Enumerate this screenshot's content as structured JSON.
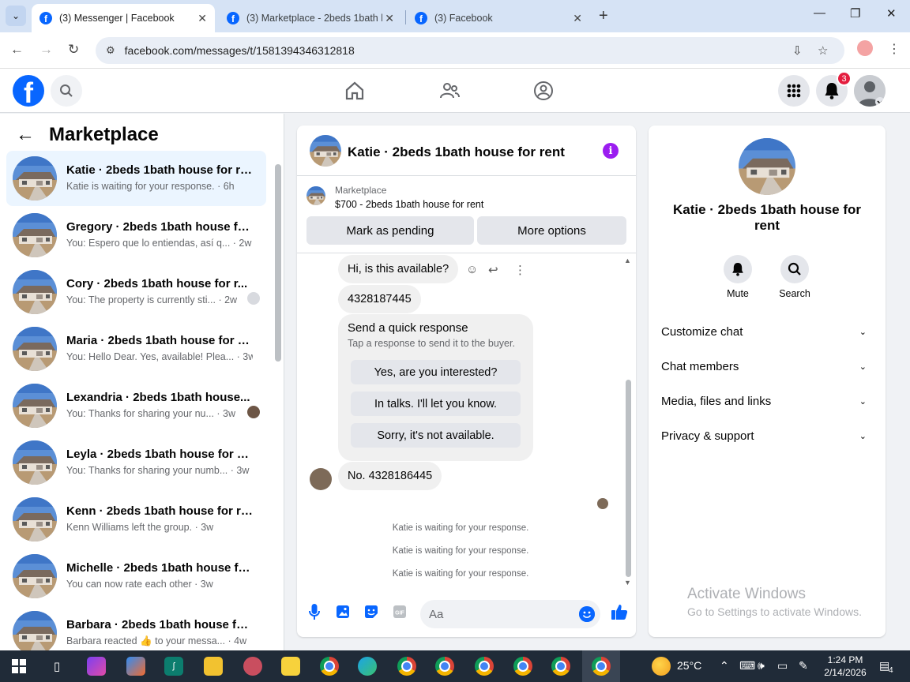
{
  "browser": {
    "tabs": [
      {
        "title": "(3) Messenger | Facebook",
        "active": true
      },
      {
        "title": "(3) Marketplace - 2beds 1bath h",
        "active": false
      },
      {
        "title": "(3) Facebook",
        "active": false
      }
    ],
    "url": "facebook.com/messages/t/1581394346312818"
  },
  "header": {
    "notification_count": "3"
  },
  "left": {
    "title": "Marketplace",
    "conversations": [
      {
        "name": "Katie · 2beds 1bath house for rent",
        "preview": "Katie is waiting for your response. · 6h",
        "selected": true
      },
      {
        "name": "Gregory · 2beds 1bath house for...",
        "preview": "You: Espero que lo entiendas, así q... · 2w"
      },
      {
        "name": "Cory · 2beds 1bath house for r...",
        "preview": "You: The property is currently sti... · 2w"
      },
      {
        "name": "Maria · 2beds 1bath house for re...",
        "preview": "You: Hello Dear. Yes, available! Plea... · 3w"
      },
      {
        "name": "Lexandria · 2beds 1bath house...",
        "preview": "You: Thanks for sharing your nu... · 3w"
      },
      {
        "name": "Leyla · 2beds 1bath house for rent",
        "preview": "You: Thanks for sharing your numb... · 3w"
      },
      {
        "name": "Kenn · 2beds 1bath house for rent",
        "preview": "Kenn Williams left the group. · 3w"
      },
      {
        "name": "Michelle · 2beds 1bath house for...",
        "preview": "You can now rate each other · 3w"
      },
      {
        "name": "Barbara · 2beds 1bath house for ...",
        "preview": "Barbara reacted 👍 to your messa... · 4w"
      }
    ]
  },
  "chat": {
    "title": "Katie · 2beds 1bath house for rent",
    "marketplace_label": "Marketplace",
    "listing": "$700 - 2beds 1bath house for rent",
    "mark_pending": "Mark as pending",
    "more_options": "More options",
    "messages": {
      "m1": "Hi, is this available?",
      "m2": "4328187445",
      "m3": "No. 4328186445"
    },
    "quick_response": {
      "title": "Send a quick response",
      "subtitle": "Tap a response to send it to the buyer.",
      "options": [
        "Yes, are you interested?",
        "In talks. I'll let you know.",
        "Sorry, it's not available."
      ]
    },
    "system": [
      "Katie is waiting for your response.",
      "Katie is waiting for your response.",
      "Katie is waiting for your response."
    ],
    "composer_placeholder": "Aa"
  },
  "right": {
    "name": "Katie · 2beds 1bath house for rent",
    "mute": "Mute",
    "search": "Search",
    "sections": [
      "Customize chat",
      "Chat members",
      "Media, files and links",
      "Privacy & support"
    ]
  },
  "watermark": {
    "line1": "Activate Windows",
    "line2": "Go to Settings to activate Windows."
  },
  "taskbar": {
    "weather": "25°C",
    "time": "1:24 PM",
    "date": "2/14/2026",
    "notif": "4"
  },
  "colors": {
    "fb_blue": "#0866ff",
    "selected_row": "#ebf5ff",
    "info_purple": "#9b1df0"
  }
}
